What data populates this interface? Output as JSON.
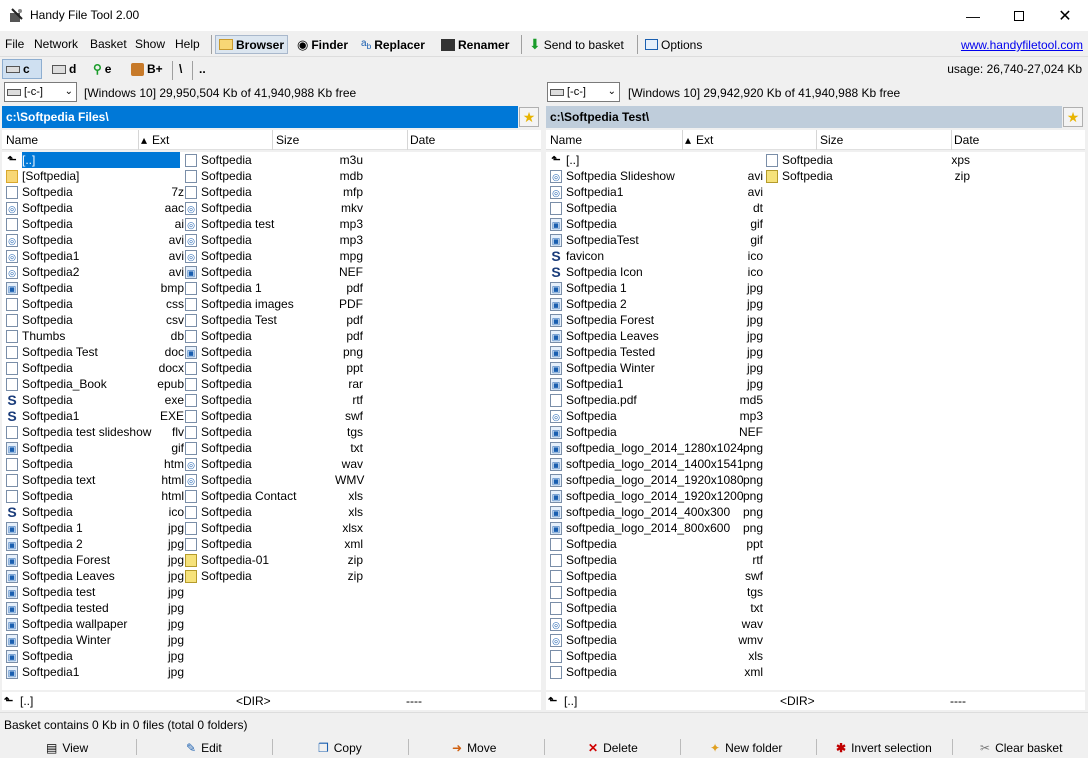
{
  "window": {
    "title": "Handy File Tool 2.00"
  },
  "menu": [
    "File",
    "Network",
    "Basket",
    "Show",
    "Help"
  ],
  "toolbar": {
    "browser": "Browser",
    "finder": "Finder",
    "replacer": "Replacer",
    "renamer": "Renamer",
    "send_to_basket": "Send to basket",
    "options": "Options",
    "website": "www.handyfiletool.com"
  },
  "drives": {
    "c": "c",
    "d": "d",
    "e": "e",
    "bplus": "B+",
    "root": "\\",
    "up": ".."
  },
  "usage": "usage: 26,740-27,024 Kb",
  "left": {
    "drive": "[-c-]",
    "info": "[Windows 10]  29,950,504 Kb of 41,940,988 Kb free",
    "path": "c:\\Softpedia Files\\",
    "columns": {
      "name": "Name",
      "ext": "Ext",
      "size": "Size",
      "date": "Date"
    },
    "col1": [
      {
        "n": "[..]",
        "e": "",
        "t": "up"
      },
      {
        "n": "[Softpedia]",
        "e": "",
        "t": "folder"
      },
      {
        "n": "Softpedia",
        "e": "7z",
        "t": "file"
      },
      {
        "n": "Softpedia",
        "e": "aac",
        "t": "media"
      },
      {
        "n": "Softpedia",
        "e": "ai",
        "t": "file"
      },
      {
        "n": "Softpedia",
        "e": "avi",
        "t": "media"
      },
      {
        "n": "Softpedia1",
        "e": "avi",
        "t": "media"
      },
      {
        "n": "Softpedia2",
        "e": "avi",
        "t": "media"
      },
      {
        "n": "Softpedia",
        "e": "bmp",
        "t": "img"
      },
      {
        "n": "Softpedia",
        "e": "css",
        "t": "file"
      },
      {
        "n": "Softpedia",
        "e": "csv",
        "t": "file"
      },
      {
        "n": "Thumbs",
        "e": "db",
        "t": "file"
      },
      {
        "n": "Softpedia Test",
        "e": "doc",
        "t": "file"
      },
      {
        "n": "Softpedia",
        "e": "docx",
        "t": "file"
      },
      {
        "n": "Softpedia_Book",
        "e": "epub",
        "t": "file"
      },
      {
        "n": "Softpedia",
        "e": "exe",
        "t": "sico"
      },
      {
        "n": "Softpedia1",
        "e": "EXE",
        "t": "sico"
      },
      {
        "n": "Softpedia test slideshow",
        "e": "flv",
        "t": "file"
      },
      {
        "n": "Softpedia",
        "e": "gif",
        "t": "img"
      },
      {
        "n": "Softpedia",
        "e": "htm",
        "t": "file"
      },
      {
        "n": "Softpedia text",
        "e": "html",
        "t": "file"
      },
      {
        "n": "Softpedia",
        "e": "html",
        "t": "file"
      },
      {
        "n": "Softpedia",
        "e": "ico",
        "t": "sico"
      },
      {
        "n": "Softpedia 1",
        "e": "jpg",
        "t": "img"
      },
      {
        "n": "Softpedia 2",
        "e": "jpg",
        "t": "img"
      },
      {
        "n": "Softpedia Forest",
        "e": "jpg",
        "t": "img"
      },
      {
        "n": "Softpedia Leaves",
        "e": "jpg",
        "t": "img"
      },
      {
        "n": "Softpedia test",
        "e": "jpg",
        "t": "img"
      },
      {
        "n": "Softpedia tested",
        "e": "jpg",
        "t": "img"
      },
      {
        "n": "Softpedia wallpaper",
        "e": "jpg",
        "t": "img"
      },
      {
        "n": "Softpedia Winter",
        "e": "jpg",
        "t": "img"
      },
      {
        "n": "Softpedia",
        "e": "jpg",
        "t": "img"
      },
      {
        "n": "Softpedia1",
        "e": "jpg",
        "t": "img"
      }
    ],
    "col2": [
      {
        "n": "Softpedia",
        "e": "m3u",
        "t": "file"
      },
      {
        "n": "Softpedia",
        "e": "mdb",
        "t": "file"
      },
      {
        "n": "Softpedia",
        "e": "mfp",
        "t": "file"
      },
      {
        "n": "Softpedia",
        "e": "mkv",
        "t": "media"
      },
      {
        "n": "Softpedia test",
        "e": "mp3",
        "t": "media"
      },
      {
        "n": "Softpedia",
        "e": "mp3",
        "t": "media"
      },
      {
        "n": "Softpedia",
        "e": "mpg",
        "t": "media"
      },
      {
        "n": "Softpedia",
        "e": "NEF",
        "t": "img"
      },
      {
        "n": "Softpedia 1",
        "e": "pdf",
        "t": "file"
      },
      {
        "n": "Softpedia images",
        "e": "PDF",
        "t": "file"
      },
      {
        "n": "Softpedia Test",
        "e": "pdf",
        "t": "file"
      },
      {
        "n": "Softpedia",
        "e": "pdf",
        "t": "file"
      },
      {
        "n": "Softpedia",
        "e": "png",
        "t": "img"
      },
      {
        "n": "Softpedia",
        "e": "ppt",
        "t": "file"
      },
      {
        "n": "Softpedia",
        "e": "rar",
        "t": "file"
      },
      {
        "n": "Softpedia",
        "e": "rtf",
        "t": "file"
      },
      {
        "n": "Softpedia",
        "e": "swf",
        "t": "file"
      },
      {
        "n": "Softpedia",
        "e": "tgs",
        "t": "file"
      },
      {
        "n": "Softpedia",
        "e": "txt",
        "t": "file"
      },
      {
        "n": "Softpedia",
        "e": "wav",
        "t": "media"
      },
      {
        "n": "Softpedia",
        "e": "WMV",
        "t": "media"
      },
      {
        "n": "Softpedia Contact",
        "e": "xls",
        "t": "file"
      },
      {
        "n": "Softpedia",
        "e": "xls",
        "t": "file"
      },
      {
        "n": "Softpedia",
        "e": "xlsx",
        "t": "file"
      },
      {
        "n": "Softpedia",
        "e": "xml",
        "t": "file"
      },
      {
        "n": "Softpedia-01",
        "e": "zip",
        "t": "zip"
      },
      {
        "n": "Softpedia",
        "e": "zip",
        "t": "zip"
      }
    ],
    "footer": {
      "name": "[..]",
      "size": "<DIR>",
      "date": "----"
    }
  },
  "right": {
    "drive": "[-c-]",
    "info": "[Windows 10]  29,942,920 Kb of 41,940,988 Kb free",
    "path": "c:\\Softpedia Test\\",
    "columns": {
      "name": "Name",
      "ext": "Ext",
      "size": "Size",
      "date": "Date"
    },
    "col1": [
      {
        "n": "[..]",
        "e": "",
        "t": "up"
      },
      {
        "n": "Softpedia Slideshow",
        "e": "avi",
        "t": "media"
      },
      {
        "n": "Softpedia1",
        "e": "avi",
        "t": "media"
      },
      {
        "n": "Softpedia",
        "e": "dt",
        "t": "file"
      },
      {
        "n": "Softpedia",
        "e": "gif",
        "t": "img"
      },
      {
        "n": "SoftpediaTest",
        "e": "gif",
        "t": "img"
      },
      {
        "n": "favicon",
        "e": "ico",
        "t": "sico"
      },
      {
        "n": "Softpedia Icon",
        "e": "ico",
        "t": "sico"
      },
      {
        "n": "Softpedia 1",
        "e": "jpg",
        "t": "img"
      },
      {
        "n": "Softpedia 2",
        "e": "jpg",
        "t": "img"
      },
      {
        "n": "Softpedia Forest",
        "e": "jpg",
        "t": "img"
      },
      {
        "n": "Softpedia Leaves",
        "e": "jpg",
        "t": "img"
      },
      {
        "n": "Softpedia Tested",
        "e": "jpg",
        "t": "img"
      },
      {
        "n": "Softpedia Winter",
        "e": "jpg",
        "t": "img"
      },
      {
        "n": "Softpedia1",
        "e": "jpg",
        "t": "img"
      },
      {
        "n": "Softpedia.pdf",
        "e": "md5",
        "t": "file"
      },
      {
        "n": "Softpedia",
        "e": "mp3",
        "t": "media"
      },
      {
        "n": "Softpedia",
        "e": "NEF",
        "t": "img"
      },
      {
        "n": "softpedia_logo_2014_1280x1024",
        "e": "png",
        "t": "img"
      },
      {
        "n": "softpedia_logo_2014_1400x1541",
        "e": "png",
        "t": "img"
      },
      {
        "n": "softpedia_logo_2014_1920x1080",
        "e": "png",
        "t": "img"
      },
      {
        "n": "softpedia_logo_2014_1920x1200",
        "e": "png",
        "t": "img"
      },
      {
        "n": "softpedia_logo_2014_400x300",
        "e": "png",
        "t": "img"
      },
      {
        "n": "softpedia_logo_2014_800x600",
        "e": "png",
        "t": "img"
      },
      {
        "n": "Softpedia",
        "e": "ppt",
        "t": "file"
      },
      {
        "n": "Softpedia",
        "e": "rtf",
        "t": "file"
      },
      {
        "n": "Softpedia",
        "e": "swf",
        "t": "file"
      },
      {
        "n": "Softpedia",
        "e": "tgs",
        "t": "file"
      },
      {
        "n": "Softpedia",
        "e": "txt",
        "t": "file"
      },
      {
        "n": "Softpedia",
        "e": "wav",
        "t": "media"
      },
      {
        "n": "Softpedia",
        "e": "wmv",
        "t": "media"
      },
      {
        "n": "Softpedia",
        "e": "xls",
        "t": "file"
      },
      {
        "n": "Softpedia",
        "e": "xml",
        "t": "file"
      }
    ],
    "col2": [
      {
        "n": "Softpedia",
        "e": "xps",
        "t": "file"
      },
      {
        "n": "Softpedia",
        "e": "zip",
        "t": "zip"
      }
    ],
    "footer": {
      "name": "[..]",
      "size": "<DIR>",
      "date": "----"
    }
  },
  "status": "Basket contains 0 Kb in 0 files (total 0 folders)",
  "actions": {
    "view": "View",
    "edit": "Edit",
    "copy": "Copy",
    "move": "Move",
    "delete": "Delete",
    "new_folder": "New folder",
    "invert": "Invert selection",
    "clear": "Clear basket"
  },
  "colors": {
    "active_path": "#0078d7",
    "inactive_path": "#bfcddb",
    "link": "#0000ee",
    "delete": "#d00000"
  }
}
